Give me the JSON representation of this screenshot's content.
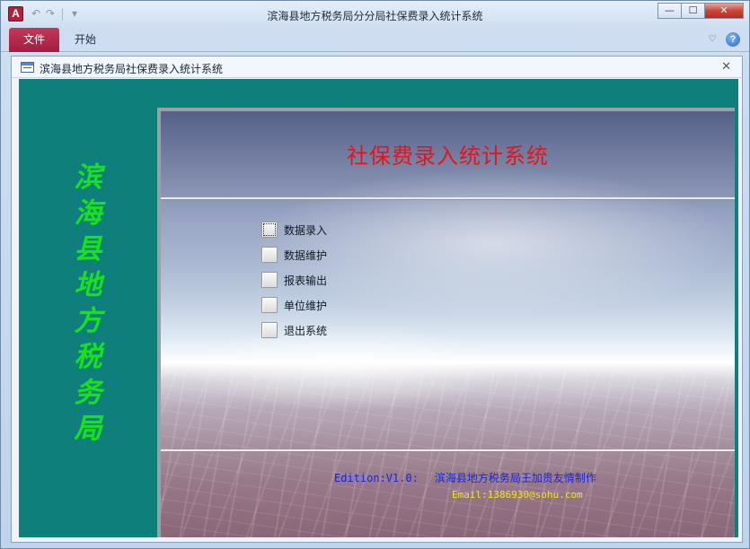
{
  "app": {
    "logo_letter": "A",
    "window_title": "滨海县地方税务局分分局社保费录入统计系统",
    "qat": {
      "undo": "↶",
      "redo": "↷",
      "more": "▾"
    },
    "controls": {
      "minimize": "—",
      "maximize": "☐",
      "close": "✕"
    }
  },
  "ribbon": {
    "tabs": [
      {
        "label": "文件"
      },
      {
        "label": "开始"
      }
    ],
    "minimize_icon": "♡",
    "help": "?"
  },
  "form": {
    "title": "滨海县地方税务局社保费录入统计系统",
    "close": "✕",
    "vertical_title": [
      "滨",
      "海",
      "县",
      "地",
      "方",
      "税",
      "务",
      "局"
    ],
    "main_title": "社保费录入统计系统",
    "menu": [
      {
        "label": "数据录入"
      },
      {
        "label": "数据维护"
      },
      {
        "label": "报表输出"
      },
      {
        "label": "单位维护"
      },
      {
        "label": "退出系统"
      }
    ],
    "edition": "Edition:V1.0:",
    "author": "滨海县地方税务局王加贵友情制作",
    "email": "Email:1386930@sohu.com"
  },
  "colors": {
    "file_tab": "#b5254c",
    "form_background": "#0e7f7a",
    "vertical_title": "#19e21b",
    "main_title": "#e0161d",
    "edition_text": "#1a24d8",
    "email_text": "#efe81a"
  }
}
